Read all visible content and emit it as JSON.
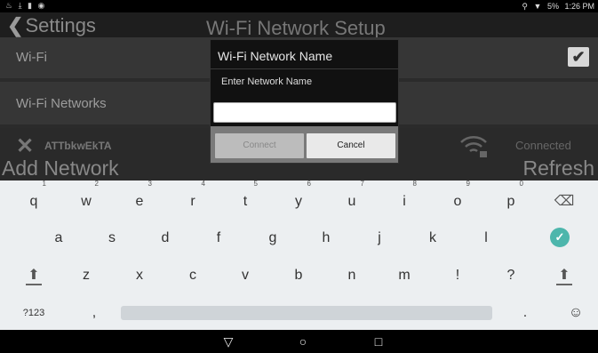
{
  "status_bar": {
    "left_icons": "♨ ⤓ ▮ ◉",
    "battery": "5%",
    "time": "1:26 PM"
  },
  "app": {
    "back_label": "Settings",
    "title": "Wi-Fi Network Setup",
    "wifi_label": "Wi-Fi",
    "wifi_enabled": true,
    "networks_label": "Wi-Fi Networks",
    "network": {
      "ssid": "ATTbkwEkTA",
      "status": "Connected"
    },
    "add_network": "Add Network",
    "refresh": "Refresh"
  },
  "dialog": {
    "title": "Wi-Fi Network Name",
    "message": "Enter Network Name",
    "input_value": "",
    "connect": "Connect",
    "cancel": "Cancel"
  },
  "keyboard": {
    "row1": [
      "q",
      "w",
      "e",
      "r",
      "t",
      "y",
      "u",
      "i",
      "o",
      "p"
    ],
    "row1_hints": [
      "1",
      "2",
      "3",
      "4",
      "5",
      "6",
      "7",
      "8",
      "9",
      "0"
    ],
    "row2": [
      "a",
      "s",
      "d",
      "f",
      "g",
      "h",
      "j",
      "k",
      "l"
    ],
    "row3": [
      "z",
      "x",
      "c",
      "v",
      "b",
      "n",
      "m",
      "!",
      "?"
    ],
    "symbols_key": "?123",
    "comma": ",",
    "period": ".",
    "emoji": "☺",
    "backspace": "⌫",
    "enter": "✓",
    "shift": "⬆"
  },
  "navbar": {
    "back": "▽",
    "home": "○",
    "recents": "□"
  },
  "colors": {
    "enter_accent": "#4db6ac",
    "app_bg": "#2b2b2b",
    "keyboard_bg": "#eceff1"
  }
}
